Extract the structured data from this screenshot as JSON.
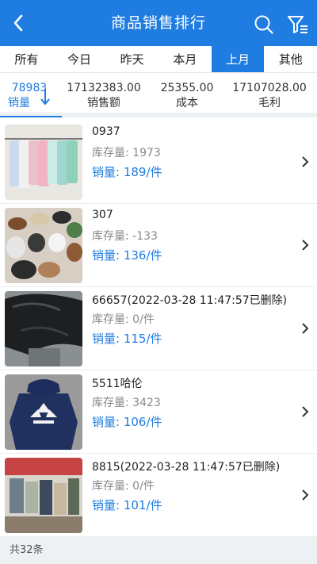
{
  "header": {
    "title": "商品销售排行"
  },
  "tabs": [
    {
      "label": "所有"
    },
    {
      "label": "今日"
    },
    {
      "label": "昨天"
    },
    {
      "label": "本月"
    },
    {
      "label": "上月",
      "active": true
    },
    {
      "label": "其他"
    }
  ],
  "stats": [
    {
      "value": "78983",
      "label": "销量",
      "active": true
    },
    {
      "value": "17132383.00",
      "label": "销售额"
    },
    {
      "value": "25355.00",
      "label": "成本"
    },
    {
      "value": "17107028.00",
      "label": "毛利"
    }
  ],
  "items": [
    {
      "name": "0937",
      "stock": "库存量:  1973",
      "sales": "销量:  189/件",
      "image": "shirts-on-rack"
    },
    {
      "name": "307",
      "stock": "库存量:  -133",
      "sales": "销量:  136/件",
      "image": "sandals-and-slippers"
    },
    {
      "name": "66657(2022-03-28 11:47:57已删除)",
      "stock": "库存量:  0/件",
      "sales": "销量:  115/件",
      "image": "black-plastic-bag"
    },
    {
      "name": "5511哈伦",
      "stock": "库存量:  3423",
      "sales": "销量:  106/件",
      "image": "navy-hoodie-logo"
    },
    {
      "name": "8815(2022-03-28 11:47:57已删除)",
      "stock": "库存量:  0/件",
      "sales": "销量:  101/件",
      "image": "market-stall"
    }
  ],
  "footer": {
    "count_text": "共32条"
  },
  "colors": {
    "accent": "#1f7ce0",
    "muted": "#888888"
  }
}
